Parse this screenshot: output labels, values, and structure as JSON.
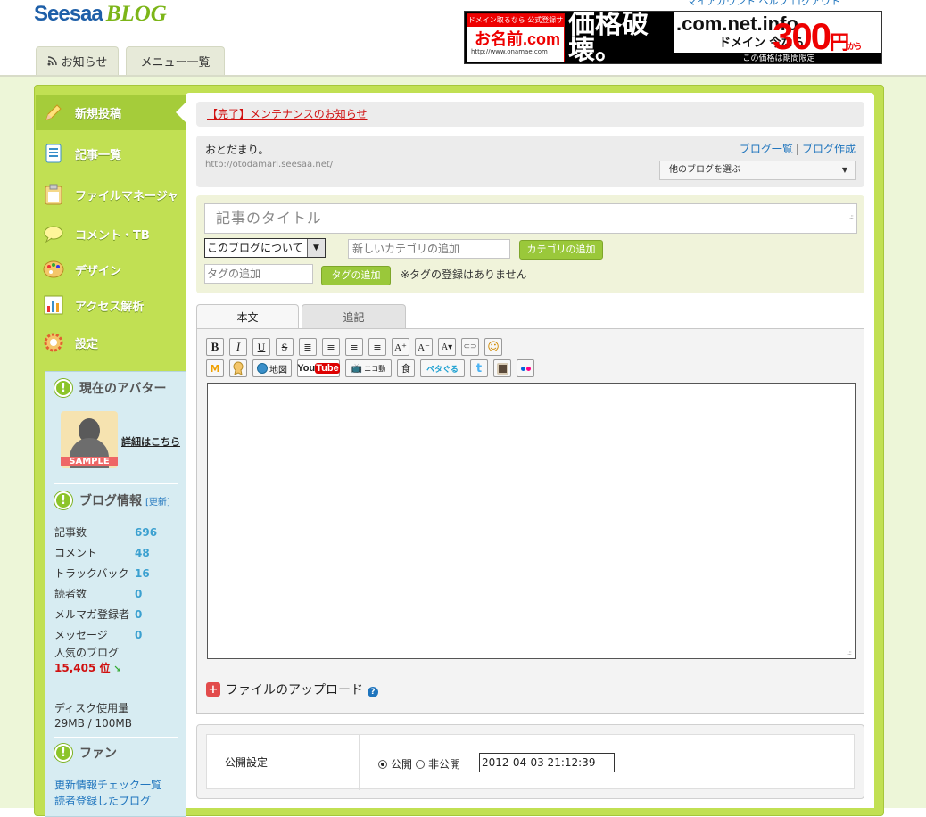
{
  "header": {
    "logo_seesaa": "Seesaa",
    "logo_blog": "BLOG",
    "top_links": "マイアカウント ヘルプ ログアウト",
    "tabs": [
      {
        "label": "お知らせ"
      },
      {
        "label": "メニュー一覧"
      }
    ]
  },
  "ad": {
    "top_small": "ドメイン取るなら 公式登録サービス",
    "brand": "お名前.com",
    "url": "http://www.onamae.com",
    "headline": "価格破壊。",
    "domains": ".com.net.info",
    "domain_suffix": "ドメイン",
    "now": "今なら",
    "price": "300",
    "yen": "円",
    "from": "から",
    "note": "この価格は期間限定"
  },
  "sidebar": {
    "items": [
      {
        "label": "新規投稿",
        "icon": "pencil-icon"
      },
      {
        "label": "記事一覧",
        "icon": "document-list-icon"
      },
      {
        "label": "ファイルマネージャ",
        "icon": "clipboard-icon"
      },
      {
        "label": "コメント・TB",
        "icon": "speech-bubble-icon"
      },
      {
        "label": "デザイン",
        "icon": "palette-icon"
      },
      {
        "label": "アクセス解析",
        "icon": "bar-chart-icon"
      },
      {
        "label": "設定",
        "icon": "gear-icon"
      }
    ]
  },
  "avatar_box": {
    "title": "現在のアバター",
    "sample": "SAMPLE",
    "detail_link": "詳細はこちら"
  },
  "blog_stats": {
    "title": "ブログ情報",
    "update": "[更新]",
    "rows": [
      {
        "label": "記事数",
        "value": "696"
      },
      {
        "label": "コメント",
        "value": "48"
      },
      {
        "label": "トラックバック",
        "value": "16"
      },
      {
        "label": "読者数",
        "value": "0"
      },
      {
        "label": "メルマガ登録者",
        "value": "0"
      },
      {
        "label": "メッセージ",
        "value": "0"
      }
    ],
    "popular_label": "人気のブログ",
    "popular_rank": "15,405 位",
    "disk_label": "ディスク使用量",
    "disk_value": "29MB / 100MB"
  },
  "fan_box": {
    "title": "ファン",
    "links": [
      "更新情報チェック一覧",
      "読者登録したブログ"
    ]
  },
  "notice": {
    "text": "【完了】メンテナンスのお知らせ"
  },
  "blog": {
    "name": "おとだまり。",
    "url": "http://otodamari.seesaa.net/",
    "link_list": "ブログ一覧",
    "link_create": "ブログ作成",
    "select_label": "他のブログを選ぶ"
  },
  "post": {
    "title_placeholder": "記事のタイトル",
    "category_selected": "このブログについて",
    "new_category_placeholder": "新しいカテゴリの追加",
    "add_category_button": "カテゴリの追加",
    "tag_placeholder": "タグの追加",
    "add_tag_button": "タグの追加",
    "no_tags": "※タグの登録はありません"
  },
  "editor": {
    "tabs": [
      {
        "label": "本文"
      },
      {
        "label": "追記"
      }
    ],
    "toolbar_row1": [
      "B",
      "I",
      "U",
      "S",
      "≣",
      "≡",
      "≡",
      "≡",
      "A⁺",
      "A⁻",
      "A▾",
      "⊂⊃",
      "☺"
    ],
    "toolbar_row2_labels": {
      "map": "地図",
      "youtube_you": "You",
      "youtube_tube": "Tube",
      "nico": "ニコ動",
      "food": "食",
      "petapeta": "ペタぐる",
      "twitter": "t"
    },
    "upload_label": "ファイルのアップロード",
    "help": "?"
  },
  "publish": {
    "label": "公開設定",
    "public": "公開",
    "private": "非公開",
    "datetime": "2012-04-03 21:12:39"
  }
}
